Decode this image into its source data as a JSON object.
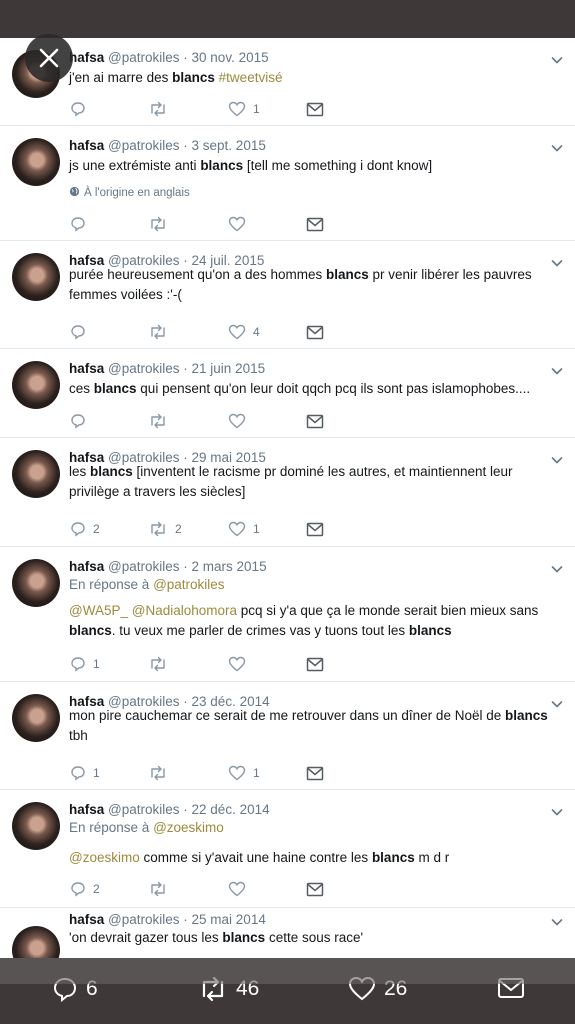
{
  "tweets": [
    {
      "name": "hafsa",
      "handle": "@patrokiles",
      "date": "30 nov. 2015",
      "parts": [
        [
          "t",
          "j'en ai marre des "
        ],
        [
          "b",
          "blancs"
        ],
        [
          "t",
          " "
        ],
        [
          "h",
          "#tweetvisé"
        ]
      ],
      "reply": "",
      "like": "1"
    },
    {
      "name": "hafsa",
      "handle": "@patrokiles",
      "date": "3 sept. 2015",
      "parts": [
        [
          "t",
          "js une extrémiste anti "
        ],
        [
          "b",
          "blancs"
        ],
        [
          "t",
          " [tell me something i dont know]"
        ]
      ],
      "origin": "À l'origine en anglais",
      "reply": "",
      "like": ""
    },
    {
      "name": "hafsa",
      "handle": "@patrokiles",
      "date": "24 juil. 2015",
      "parts": [
        [
          "t",
          "purée heureusement qu'on a des hommes "
        ],
        [
          "b",
          "blancs"
        ],
        [
          "t",
          " pr venir libérer les pauvres femmes voilées :'-("
        ]
      ],
      "reply": "",
      "like": "4"
    },
    {
      "name": "hafsa",
      "handle": "@patrokiles",
      "date": "21 juin 2015",
      "parts": [
        [
          "t",
          "ces "
        ],
        [
          "b",
          "blancs"
        ],
        [
          "t",
          " qui pensent qu'on leur doit qqch pcq ils sont pas islamophobes...."
        ]
      ],
      "reply": "",
      "like": ""
    },
    {
      "name": "hafsa",
      "handle": "@patrokiles",
      "date": "29 mai 2015",
      "parts": [
        [
          "t",
          "les "
        ],
        [
          "b",
          "blancs"
        ],
        [
          "t",
          " [inventent le racisme pr dominé les autres, et maintiennent leur privilège a travers les siècles]"
        ]
      ],
      "reply": "2",
      "retweet": "2",
      "like": "1"
    },
    {
      "name": "hafsa",
      "handle": "@patrokiles",
      "date": "2 mars 2015",
      "replying_to_label": "En réponse à",
      "replying_to": "@patrokiles",
      "parts": [
        [
          "h",
          "@WA5P_"
        ],
        [
          "t",
          " "
        ],
        [
          "h",
          "@Nadialohomora"
        ],
        [
          "t",
          " pcq si y'a que ça le monde serait bien mieux sans "
        ],
        [
          "b",
          "blancs"
        ],
        [
          "t",
          ". tu veux me parler de crimes vas y tuons tout les "
        ],
        [
          "b",
          "blancs"
        ]
      ],
      "reply": "1",
      "like": ""
    },
    {
      "name": "hafsa",
      "handle": "@patrokiles",
      "date": "23 déc. 2014",
      "parts": [
        [
          "t",
          "mon pire cauchemar ce serait de me retrouver dans un dîner de Noël de "
        ],
        [
          "b",
          "blancs"
        ],
        [
          "t",
          " tbh"
        ]
      ],
      "reply": "1",
      "like": "1"
    },
    {
      "name": "hafsa",
      "handle": "@patrokiles",
      "date": "22 déc. 2014",
      "replying_to_label": "En réponse à",
      "replying_to": "@zoeskimo",
      "parts": [
        [
          "h",
          "@zoeskimo"
        ],
        [
          "t",
          " comme si y'avait une haine contre les "
        ],
        [
          "b",
          "blancs"
        ],
        [
          "t",
          " m d r"
        ]
      ],
      "reply": "2",
      "like": ""
    },
    {
      "name": "hafsa",
      "handle": "@patrokiles",
      "date": "25 mai 2014",
      "parts": [
        [
          "t",
          "'on devrait gazer tous les "
        ],
        [
          "b",
          "blancs"
        ],
        [
          "t",
          " cette sous race'"
        ]
      ],
      "reply": "",
      "like": ""
    }
  ],
  "bottom_bar": {
    "replies": "6",
    "retweets": "46",
    "likes": "26"
  },
  "icons": {
    "close": "close-icon",
    "reply": "reply-icon",
    "retweet": "retweet-icon",
    "like": "heart-icon",
    "dm": "envelope-icon",
    "caret": "chevron-down-icon",
    "globe": "globe-icon"
  },
  "colors": {
    "link": "#9b8a3e",
    "muted": "#657786",
    "bar": "#3e3838"
  }
}
